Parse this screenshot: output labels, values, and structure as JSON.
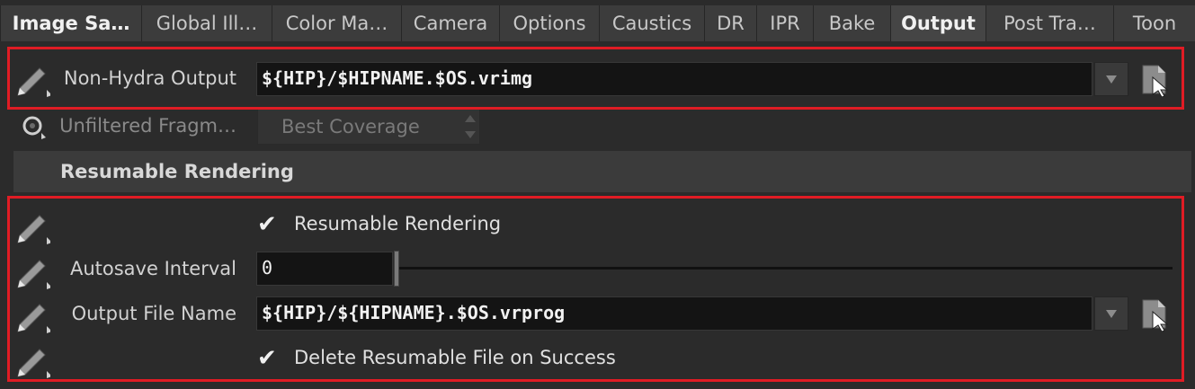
{
  "tabs": [
    {
      "label": "Image Sa…",
      "active": true
    },
    {
      "label": "Global Ill…",
      "active": false
    },
    {
      "label": "Color Ma…",
      "active": false
    },
    {
      "label": "Camera",
      "active": false
    },
    {
      "label": "Options",
      "active": false
    },
    {
      "label": "Caustics",
      "active": false
    },
    {
      "label": "DR",
      "active": false
    },
    {
      "label": "IPR",
      "active": false
    },
    {
      "label": "Bake",
      "active": false
    },
    {
      "label": "Output",
      "active": true
    },
    {
      "label": "Post Tra…",
      "active": false
    },
    {
      "label": "Toon",
      "active": false
    }
  ],
  "non_hydra": {
    "label": "Non-Hydra Output",
    "value": "${HIP}/$HIPNAME.$OS.vrimg"
  },
  "unfiltered": {
    "label": "Unfiltered Fragm…",
    "value": "Best Coverage"
  },
  "section": {
    "title": "Resumable Rendering"
  },
  "resumable": {
    "checkbox_label": "Resumable Rendering",
    "checked": true,
    "autosave_label": "Autosave Interval",
    "autosave_value": "0",
    "output_label": "Output File Name",
    "output_value": "${HIP}/${HIPNAME}.$OS.vrprog",
    "delete_label": "Delete Resumable File on Success",
    "delete_checked": true
  },
  "colors": {
    "highlight": "#e01c24",
    "background": "#2b2b2b"
  }
}
